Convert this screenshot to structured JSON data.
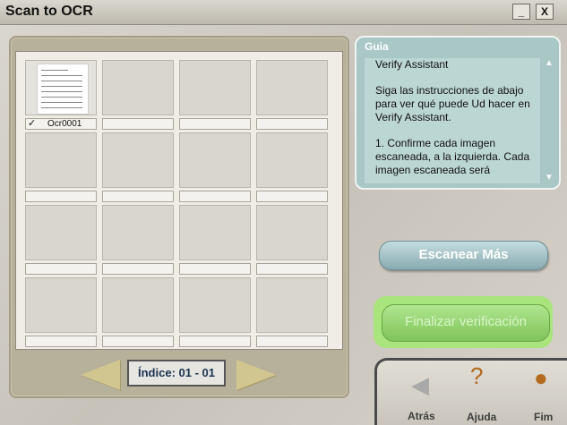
{
  "window": {
    "title": "Scan to OCR",
    "minimize_label": "_",
    "close_label": "X"
  },
  "grid": {
    "cells": [
      {
        "label": "Ocr0001",
        "checked": true,
        "has_thumbnail": true
      },
      {
        "label": ""
      },
      {
        "label": ""
      },
      {
        "label": ""
      },
      {
        "label": ""
      },
      {
        "label": ""
      },
      {
        "label": ""
      },
      {
        "label": ""
      },
      {
        "label": ""
      },
      {
        "label": ""
      },
      {
        "label": ""
      },
      {
        "label": ""
      },
      {
        "label": ""
      },
      {
        "label": ""
      },
      {
        "label": ""
      },
      {
        "label": ""
      }
    ],
    "check_glyph": "✓",
    "thumbnail_lines": [
      "DADES DE CONTACTE:",
      "Nom del centre:",
      "Nom del responsable del grup:",
      "Adreça del centre:",
      "Població i codi postal:",
      "Província:",
      "Telèfon/fax:",
      "E-mail:"
    ]
  },
  "pager": {
    "index_label": "Índice: 01 - 01",
    "prev_icon": "left-arrow-icon",
    "next_icon": "right-arrow-icon"
  },
  "guia": {
    "title": "Guia",
    "paragraphs": [
      "Verify Assistant",
      "Siga las instrucciones de abajo para ver qué puede Ud hacer en Verify Assistant.",
      "1. Confirme cada imagen escaneada, a la izquierda. Cada imagen escaneada será"
    ],
    "scroll_up": "▲",
    "scroll_down": "▼"
  },
  "buttons": {
    "scan_more": "Escanear Más",
    "finalize": "Finalizar verificación"
  },
  "nav": {
    "back": {
      "label": "Atrás",
      "icon": "back-arrow-icon",
      "glyph": "◀"
    },
    "help": {
      "label": "Ajuda",
      "icon": "question-icon",
      "glyph": "?"
    },
    "end": {
      "label": "Fim",
      "icon": "finish-icon",
      "glyph": "●"
    }
  },
  "colors": {
    "guia_panel": "#a8c7c5",
    "finalize_green": "#7fc45a",
    "scan_blue": "#88aab0"
  }
}
